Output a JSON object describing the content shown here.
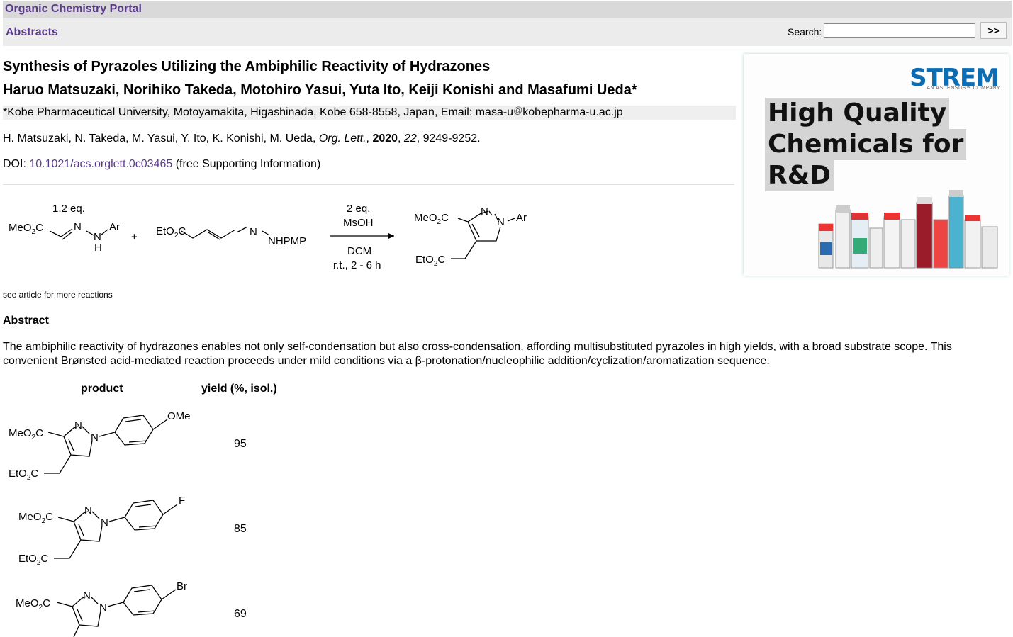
{
  "header": {
    "site_title": "Organic Chemistry Portal",
    "section": "Abstracts",
    "search_label": "Search:",
    "search_value": "",
    "search_button": ">>"
  },
  "article": {
    "title": "Synthesis of Pyrazoles Utilizing the Ambiphilic Reactivity of Hydrazones",
    "authors": "Haruo Matsuzaki, Norihiko Takeda, Motohiro Yasui, Yuta Ito, Keiji Konishi and Masafumi Ueda*",
    "affiliation_pre": "*Kobe Pharmaceutical University, Motoyamakita, Higashinada, Kobe 658-8558, Japan, Email: masa-u",
    "affiliation_at": "@",
    "affiliation_post": "kobepharma-u.ac.jp",
    "citation_authors": "H. Matsuzaki, N. Takeda, M. Yasui, Y. Ito, K. Konishi, M. Ueda, ",
    "citation_journal": "Org. Lett.",
    "citation_sep1": ", ",
    "citation_year": "2020",
    "citation_sep2": ", ",
    "citation_volume": "22",
    "citation_pages": ", 9249-9252.",
    "doi_label": "DOI: ",
    "doi_link": "10.1021/acs.orglett.0c03465",
    "doi_suffix": " (free Supporting Information)"
  },
  "scheme": {
    "reagent1_eq": "1.2 eq.",
    "conditions_top1": "2 eq.",
    "conditions_top2": "MsOH",
    "conditions_bottom1": "DCM",
    "conditions_bottom2": "r.t., 2 - 6 h",
    "plus": "+"
  },
  "see_more": "see article for more reactions",
  "abstract": {
    "heading": "Abstract",
    "text": "The ambiphilic reactivity of hydrazones enables not only self-condensation but also cross-condensation, affording multisubstituted pyrazoles in high yields, with a broad substrate scope. This convenient Brønsted acid-mediated reaction proceeds under mild conditions via a β-protonation/nucleophilic addition/cyclization/aromatization sequence."
  },
  "table": {
    "col_product": "product",
    "col_yield": "yield (%, isol.)",
    "rows": [
      {
        "substituent": "OMe",
        "yield": "95"
      },
      {
        "substituent": "F",
        "yield": "85"
      },
      {
        "substituent": "Br",
        "yield": "69"
      }
    ]
  },
  "ad": {
    "brand": "STREM",
    "brand_sub": "AN ASCENSUS™ COMPANY",
    "line1": "High Quality",
    "line2": "Chemicals for",
    "line3": "R&D"
  }
}
